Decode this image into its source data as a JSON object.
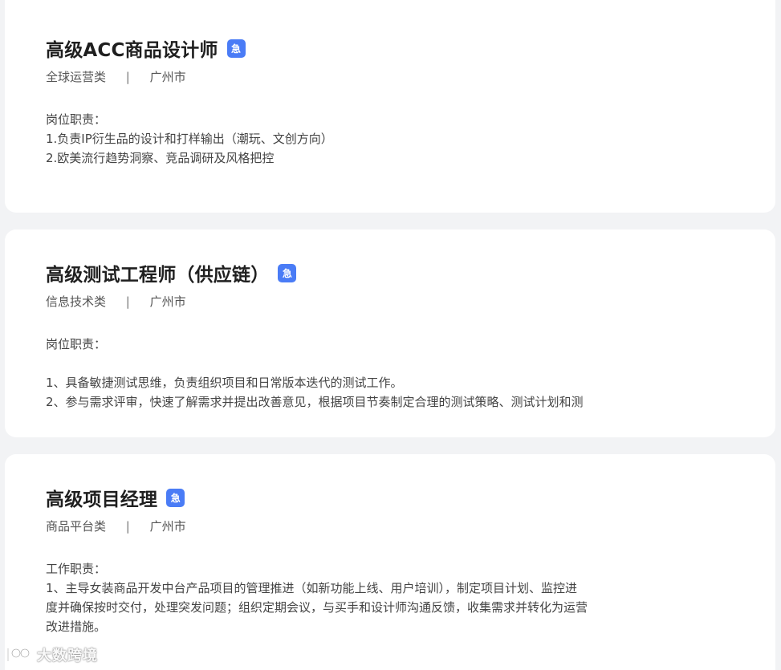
{
  "jobs": [
    {
      "title": "高级ACC商品设计师",
      "badge": "急",
      "category": "全球运营类",
      "separator": "|",
      "city": "广州市",
      "desc": [
        "岗位职责：",
        "1.负责IP衍生品的设计和打样输出（潮玩、文创方向）",
        "2.欧美流行趋势洞察、竞品调研及风格把控"
      ]
    },
    {
      "title": "高级测试工程师（供应链）",
      "badge": "急",
      "category": "信息技术类",
      "separator": "|",
      "city": "广州市",
      "desc": [
        "岗位职责：",
        "",
        "1、具备敏捷测试思维，负责组织项目和日常版本迭代的测试工作。",
        "2、参与需求评审，快速了解需求并提出改善意见，根据项目节奏制定合理的测试策略、测试计划和测"
      ]
    },
    {
      "title": "高级项目经理",
      "badge": "急",
      "category": "商品平台类",
      "separator": "|",
      "city": "广州市",
      "desc": [
        "工作职责：",
        "1、主导女装商品开发中台产品项目的管理推进（如新功能上线、用户培训），制定项目计划、监控进",
        "度并确保按时交付，处理突发问题；组织定期会议，与买手和设计师沟通反馈，收集需求并转化为运营",
        "改进措施。"
      ]
    }
  ],
  "watermark": {
    "text": "大数跨境",
    "icon": "logo-icon"
  },
  "colors": {
    "background": "#f2f3f5",
    "card": "#ffffff",
    "badge": "#4a7cf6",
    "title": "#1f1f1f"
  }
}
